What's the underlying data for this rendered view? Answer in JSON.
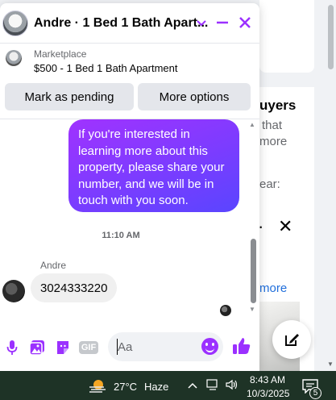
{
  "chat": {
    "title": "Andre · 1 Bed 1 Bath Apart...",
    "listing_label": "Marketplace",
    "listing_title": "$500 - 1 Bed 1 Bath Apartment",
    "buttons": {
      "pending": "Mark as pending",
      "more": "More options"
    },
    "messages": [
      {
        "from": "me",
        "text": "If you're interested in learning more about this property, please share your number, and we will be in touch with you soon."
      }
    ],
    "time_separator": "11:10 AM",
    "incoming_sender": "Andre",
    "incoming_text": "3024333220",
    "input_placeholder": "Aa"
  },
  "background": {
    "text_buyers": "uyers",
    "text_that": "that",
    "text_more": "more",
    "text_ear": "ear:",
    "text_see_more": "more"
  },
  "taskbar": {
    "temperature": "27°C",
    "weather": "Haze",
    "time": "8:43 AM",
    "date": "10/3/2025",
    "notification_count": "5"
  },
  "colors": {
    "accent": "#9b30ff",
    "bubble_gradient_start": "#a033ff",
    "bubble_gradient_end": "#5a45ff",
    "taskbar": "#1e3326"
  }
}
